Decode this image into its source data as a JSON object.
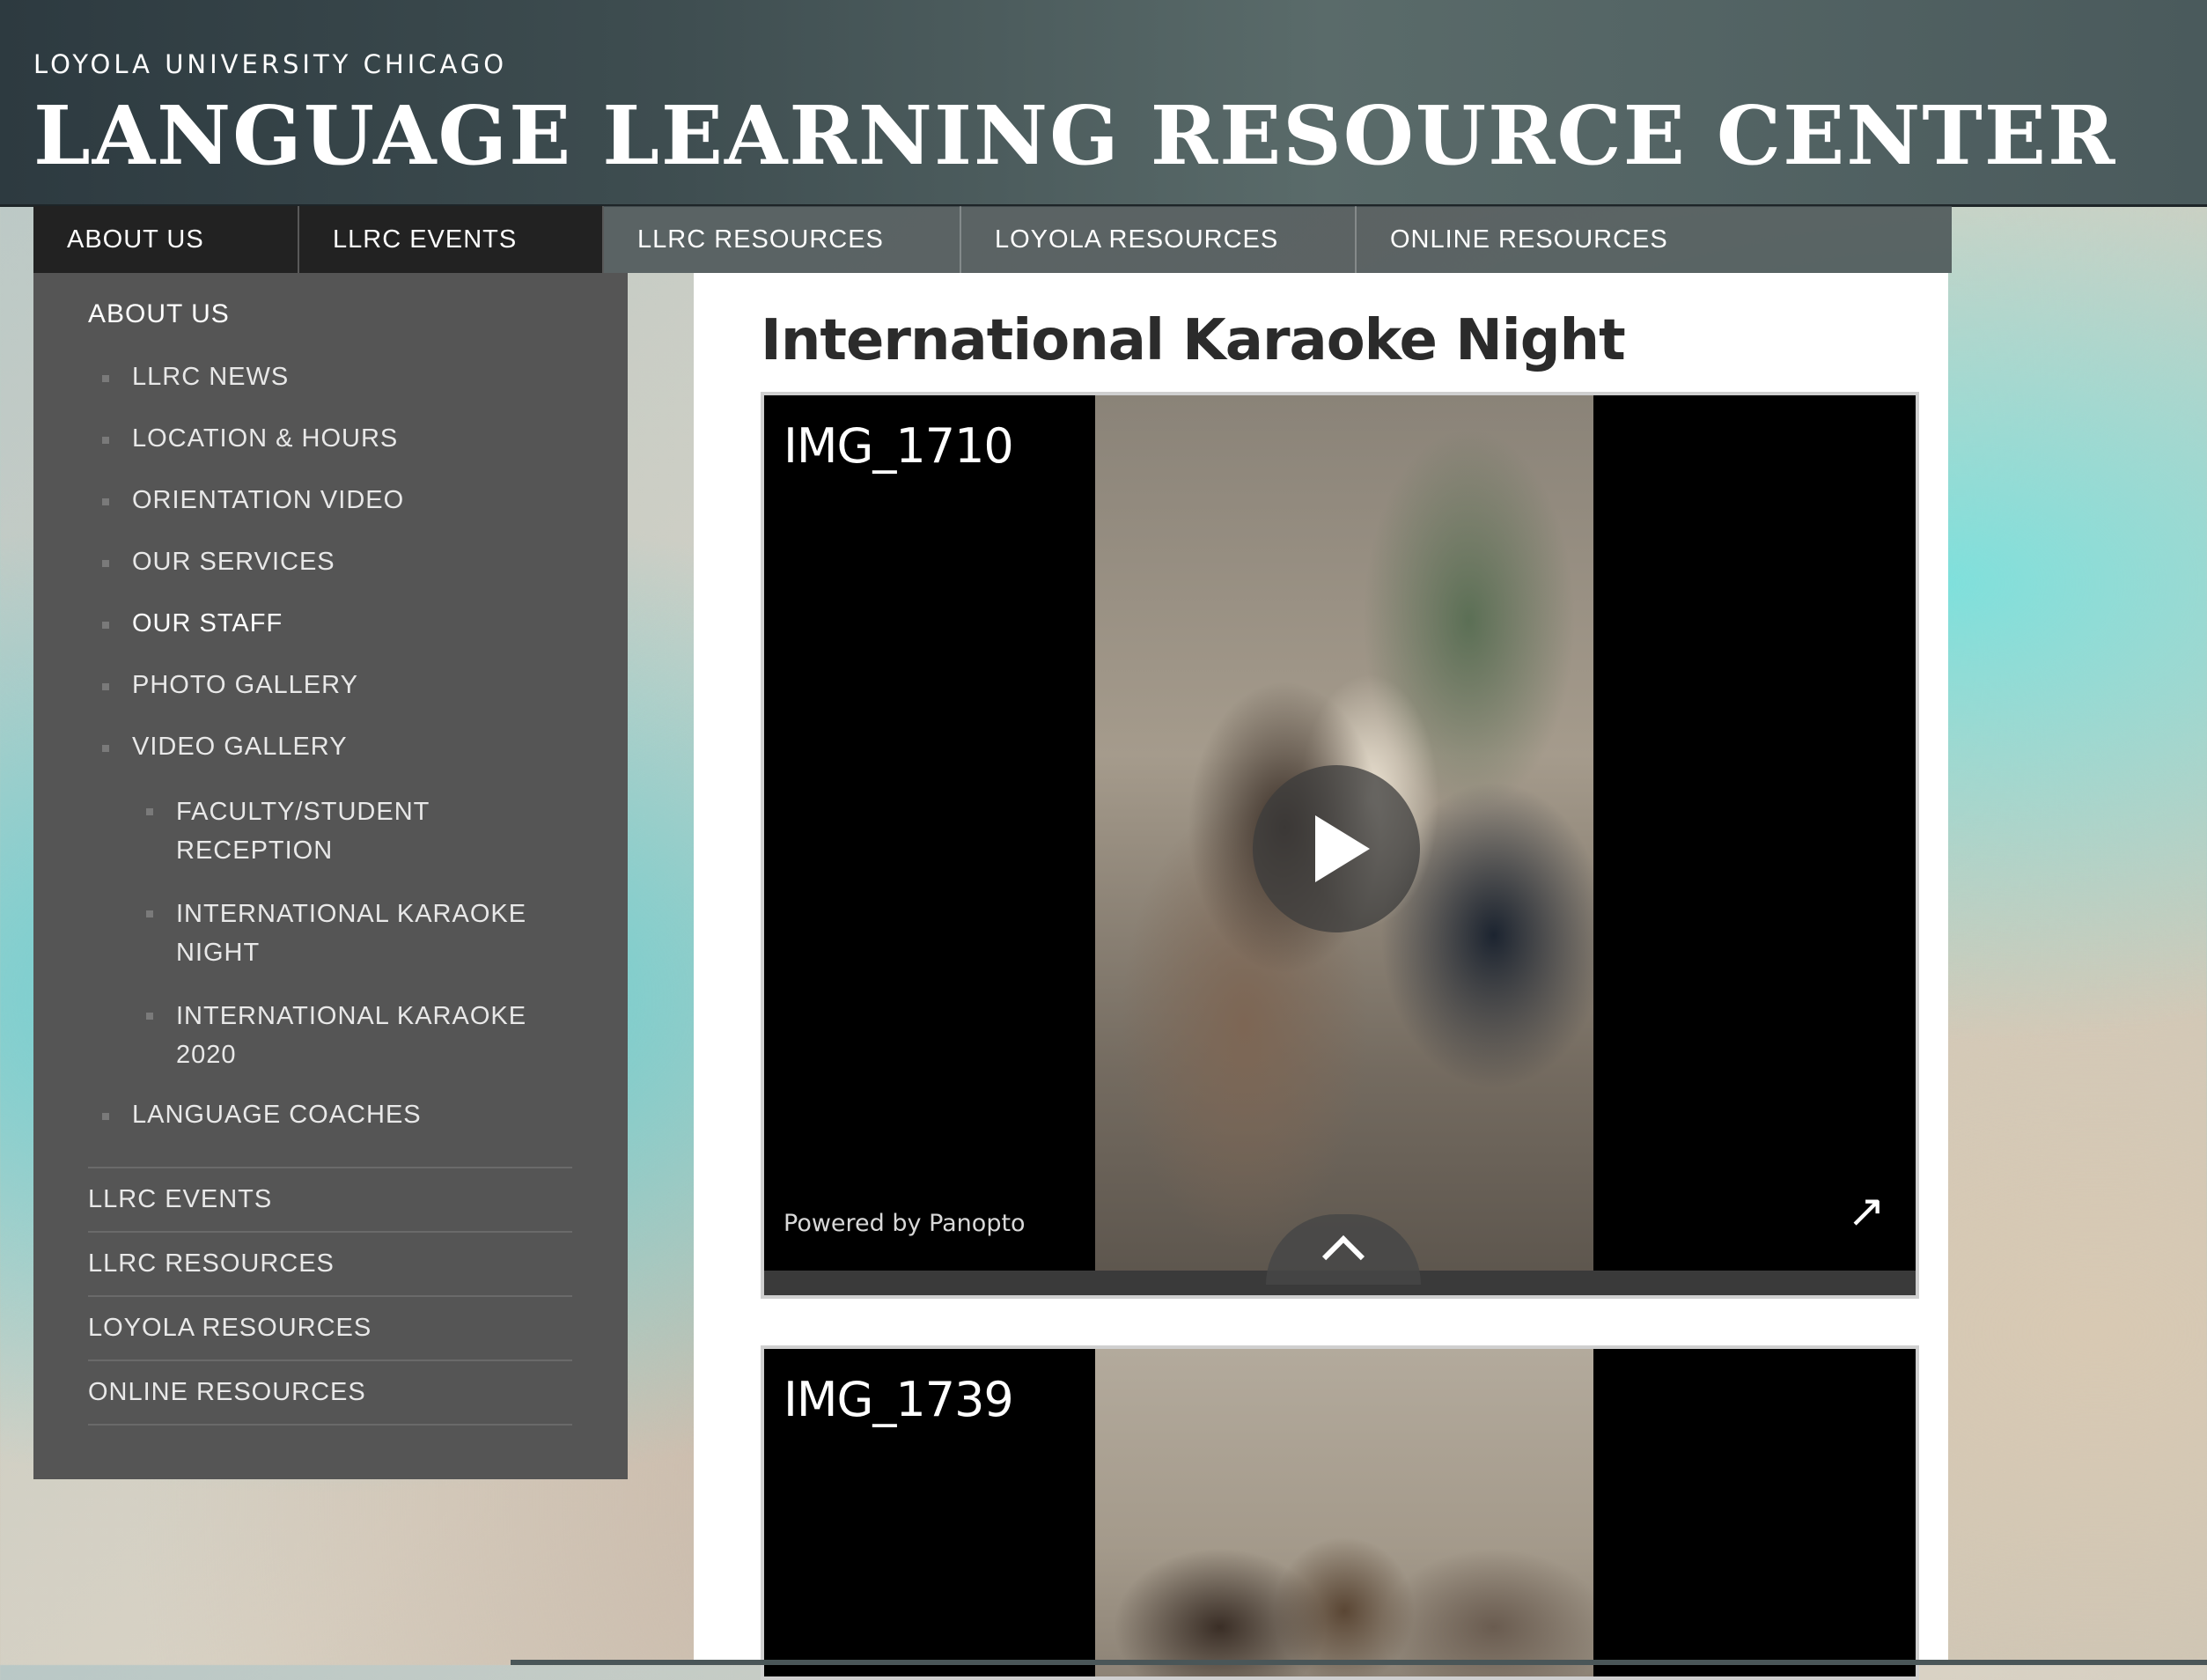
{
  "header": {
    "university": "LOYOLA UNIVERSITY CHICAGO",
    "site_title": "LANGUAGE LEARNING RESOURCE CENTER"
  },
  "topnav": [
    {
      "label": "ABOUT US"
    },
    {
      "label": "LLRC EVENTS"
    },
    {
      "label": "LLRC RESOURCES"
    },
    {
      "label": "LOYOLA RESOURCES"
    },
    {
      "label": "ONLINE RESOURCES"
    }
  ],
  "sidebar": {
    "heading": "ABOUT US",
    "items": [
      {
        "label": "LLRC NEWS"
      },
      {
        "label": "LOCATION & HOURS"
      },
      {
        "label": "ORIENTATION VIDEO"
      },
      {
        "label": "OUR SERVICES"
      },
      {
        "label": "OUR STAFF"
      },
      {
        "label": "PHOTO GALLERY"
      },
      {
        "label": "VIDEO GALLERY"
      }
    ],
    "subitems": [
      {
        "line1": "FACULTY/STUDENT",
        "line2": "RECEPTION"
      },
      {
        "line1": "INTERNATIONAL KARAOKE",
        "line2": "NIGHT"
      },
      {
        "line1": "INTERNATIONAL KARAOKE",
        "line2": "2020"
      }
    ],
    "last_item": "LANGUAGE COACHES",
    "sections": [
      {
        "label": "LLRC EVENTS"
      },
      {
        "label": "LLRC RESOURCES"
      },
      {
        "label": "LOYOLA RESOURCES"
      },
      {
        "label": "ONLINE RESOURCES"
      }
    ]
  },
  "main": {
    "title": "International Karaoke Night",
    "videos": [
      {
        "title": "IMG_1710",
        "powered_by": "Powered by Panopto"
      },
      {
        "title": "IMG_1739"
      }
    ]
  },
  "icons": {
    "play": "play-icon",
    "popout": "external-link-icon",
    "expand": "chevron-up-icon"
  }
}
